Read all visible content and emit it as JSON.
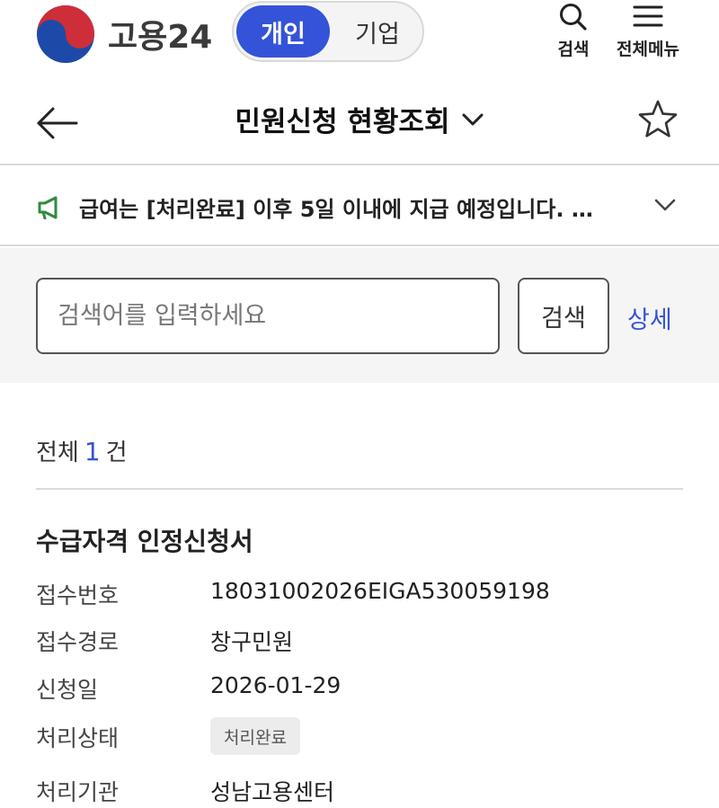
{
  "header": {
    "brand": "고용24",
    "segment": {
      "active": "개인",
      "inactive": "기업"
    },
    "search_label": "검색",
    "menu_label": "전체메뉴"
  },
  "titlebar": {
    "title": "민원신청 현황조회"
  },
  "notice": {
    "text": "급여는 [처리완료] 이후 5일 이내에 지급 예정입니다. …"
  },
  "search": {
    "placeholder": "검색어를 입력하세요",
    "button_label": "검색",
    "detail_label": "상세"
  },
  "results": {
    "count_prefix": "전체",
    "count": "1",
    "count_suffix": "건",
    "item": {
      "title": "수급자격 인정신청서",
      "fields": [
        {
          "label": "접수번호",
          "value": "18031002026EIGA530059198"
        },
        {
          "label": "접수경로",
          "value": "창구민원"
        },
        {
          "label": "신청일",
          "value": "2026-01-29"
        },
        {
          "label": "처리상태",
          "value": "처리완료"
        },
        {
          "label": "처리기관",
          "value": "성남고용센터"
        }
      ]
    }
  },
  "colors": {
    "accent": "#3553d8",
    "notice_icon": "#2e8b3d",
    "divider": "#d9d9d9"
  }
}
